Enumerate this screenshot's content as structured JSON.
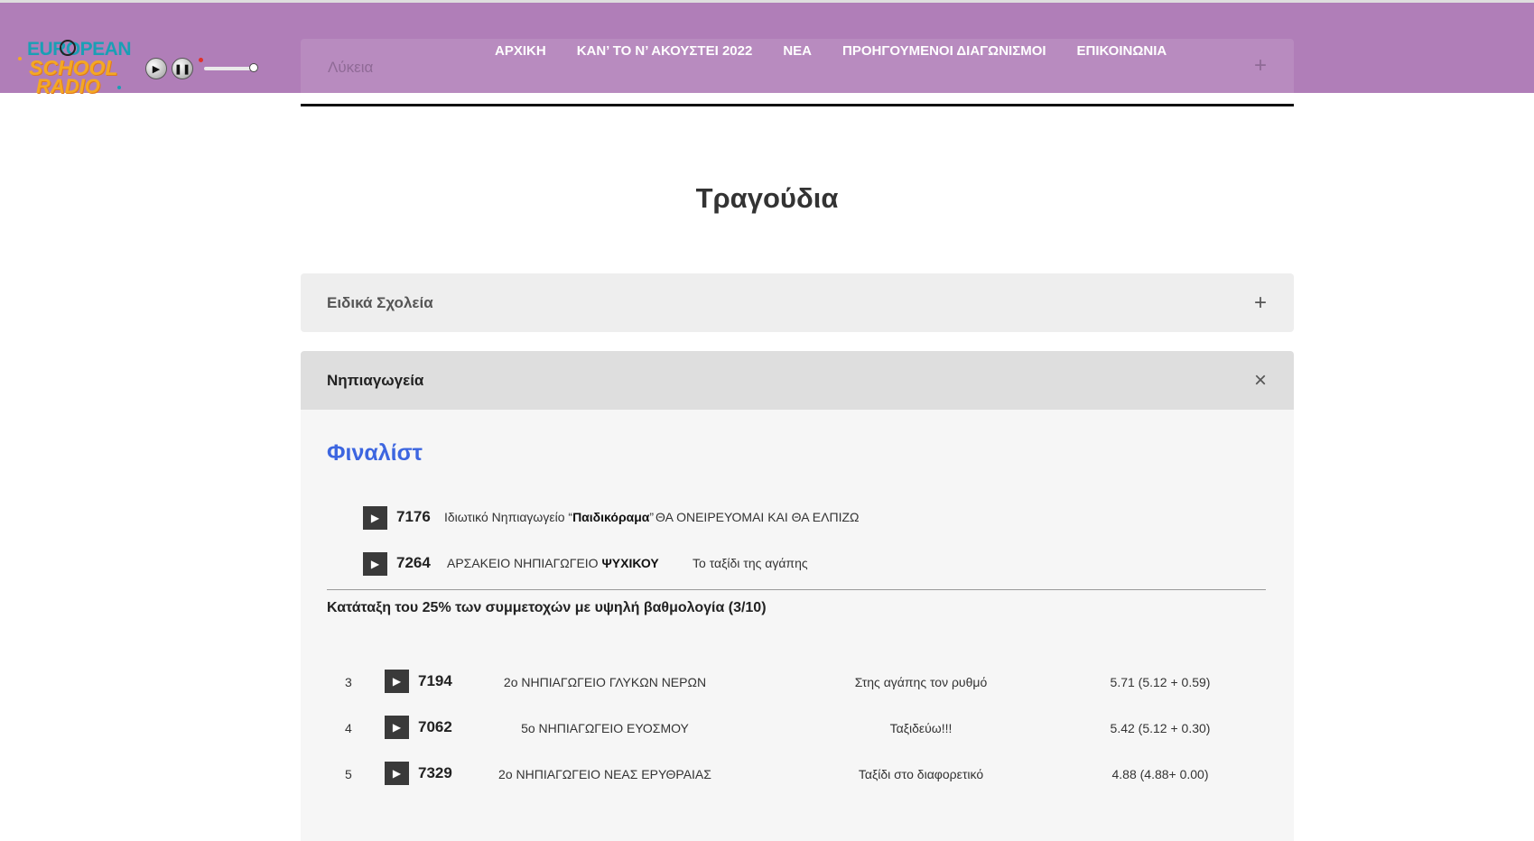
{
  "colors": {
    "header_bg": "#b07eb8",
    "accent_blue": "#3d66e0",
    "play_box": "#3a3a3a",
    "accordion_closed": "#eeeeee",
    "accordion_open": "#dedede"
  },
  "logo": {
    "line1": "EUROPEAN",
    "line2": "SCHOOL",
    "line3": "RADIO"
  },
  "player": {
    "play_icon": "play-icon",
    "pause_icon": "pause-icon"
  },
  "nav": {
    "items": [
      "ΑΡΧΙΚΗ",
      "ΚΑΝ’ ΤΟ Ν’ ΑΚΟΥΣΤΕΙ 2022",
      "ΝΕΑ",
      "ΠΡΟΗΓΟΥΜΕΝΟΙ ΔΙΑΓΩΝΙΣΜΟΙ",
      "ΕΠΙΚΟΙΝΩΝΙΑ"
    ]
  },
  "top_accordion": {
    "label": "Λύκεια",
    "icon": "+"
  },
  "section": {
    "title": "Τραγούδια"
  },
  "accordions": {
    "eidika": {
      "label": "Ειδικά Σχολεία",
      "icon": "+"
    },
    "nipiagogeia": {
      "label": "Νηπιαγωγεία",
      "icon": "×"
    }
  },
  "finalists": {
    "title": "Φιναλίστ",
    "items": [
      {
        "id": "7176",
        "school_prefix": "Ιδιωτικό Νηπιαγωγείο “",
        "school_bold": "Παιδικόραμα",
        "school_suffix": "”",
        "song": "ΘΑ ΟΝΕΙΡΕΥΟΜΑΙ ΚΑΙ ΘΑ ΕΛΠΙΖΩ"
      },
      {
        "id": "7264",
        "school_prefix": "ΑΡΣΑΚΕΙΟ ΝΗΠΙΑΓΩΓΕΙΟ ",
        "school_bold": "ΨΥΧΙΚΟΥ",
        "school_suffix": "",
        "song": "Το ταξίδι της αγάπης"
      }
    ]
  },
  "ranking": {
    "heading": "Κατάταξη του 25% των συμμετοχών με υψηλή βαθμολογία (3/10)",
    "rows": [
      {
        "rank": "3",
        "id": "7194",
        "school": "2ο ΝΗΠΙΑΓΩΓΕΙΟ ΓΛΥΚΩΝ ΝΕΡΩΝ",
        "song": "Στης αγάπης τον ρυθμό",
        "score": "5.71 (5.12 + 0.59)"
      },
      {
        "rank": "4",
        "id": "7062",
        "school": "5ο ΝΗΠΙΑΓΩΓΕΙΟ ΕΥΟΣΜΟΥ",
        "song": "Ταξιδεύω!!!",
        "score": "5.42 (5.12 + 0.30)"
      },
      {
        "rank": "5",
        "id": "7329",
        "school": "2ο ΝΗΠΙΑΓΩΓΕΙΟ ΝΕΑΣ ΕΡΥΘΡΑΙΑΣ",
        "song": "Ταξίδι στο διαφορετικό",
        "score": "4.88 (4.88+ 0.00)"
      }
    ]
  }
}
